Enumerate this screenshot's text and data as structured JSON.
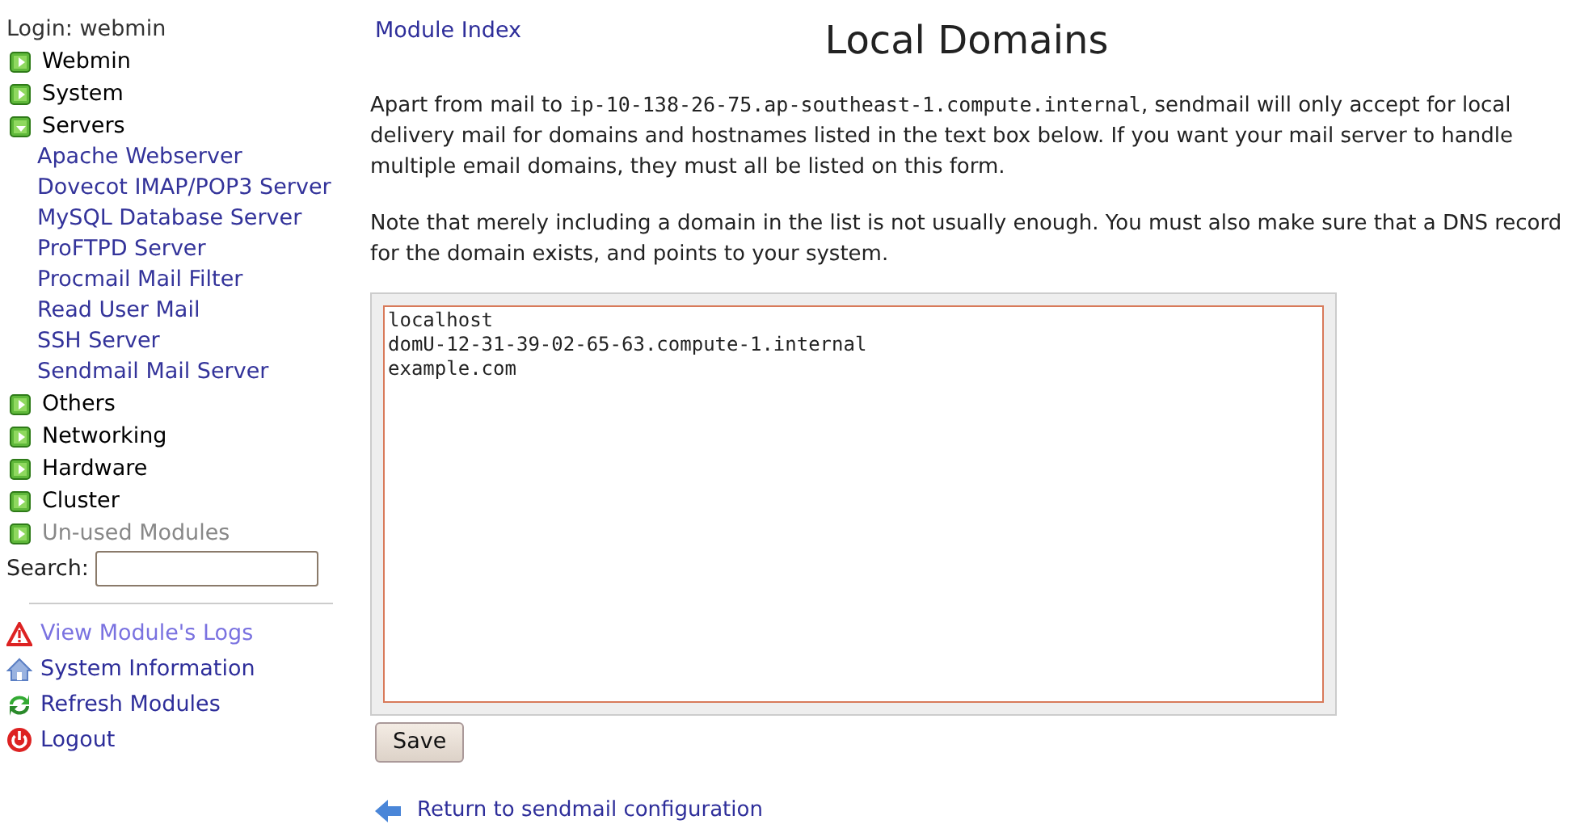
{
  "sidebar": {
    "login": "Login: webmin",
    "categories": [
      {
        "label": "Webmin",
        "expanded": false,
        "disabled": false
      },
      {
        "label": "System",
        "expanded": false,
        "disabled": false
      },
      {
        "label": "Servers",
        "expanded": true,
        "disabled": false,
        "children": [
          "Apache Webserver",
          "Dovecot IMAP/POP3 Server",
          "MySQL Database Server",
          "ProFTPD Server",
          "Procmail Mail Filter",
          "Read User Mail",
          "SSH Server",
          "Sendmail Mail Server"
        ]
      },
      {
        "label": "Others",
        "expanded": false,
        "disabled": false
      },
      {
        "label": "Networking",
        "expanded": false,
        "disabled": false
      },
      {
        "label": "Hardware",
        "expanded": false,
        "disabled": false
      },
      {
        "label": "Cluster",
        "expanded": false,
        "disabled": false
      },
      {
        "label": "Un-used Modules",
        "expanded": false,
        "disabled": true
      }
    ],
    "search": {
      "label": "Search:"
    },
    "links": [
      {
        "kind": "warning",
        "label": "View Module's Logs",
        "visited": true
      },
      {
        "kind": "home",
        "label": "System Information",
        "visited": false
      },
      {
        "kind": "refresh",
        "label": "Refresh Modules",
        "visited": false
      },
      {
        "kind": "power",
        "label": "Logout",
        "visited": false
      }
    ]
  },
  "main": {
    "module_index": "Module Index",
    "title": "Local Domains",
    "intro_start": "Apart from mail to",
    "intro_host": "ip-10-138-26-75.ap-southeast-1.compute.internal",
    "intro_end": ", sendmail will only accept for local delivery mail for domains and hostnames listed in the text box below. If you want your mail server to handle multiple email domains, they must all be listed on this form.",
    "note": "Note that merely including a domain in the list is not usually enough. You must also make sure that a DNS record for the domain exists, and points to your system.",
    "domains": [
      "localhost",
      "domU-12-31-39-02-65-63.compute-1.internal",
      "example.com"
    ],
    "save": "Save",
    "return": "Return to sendmail configuration"
  }
}
